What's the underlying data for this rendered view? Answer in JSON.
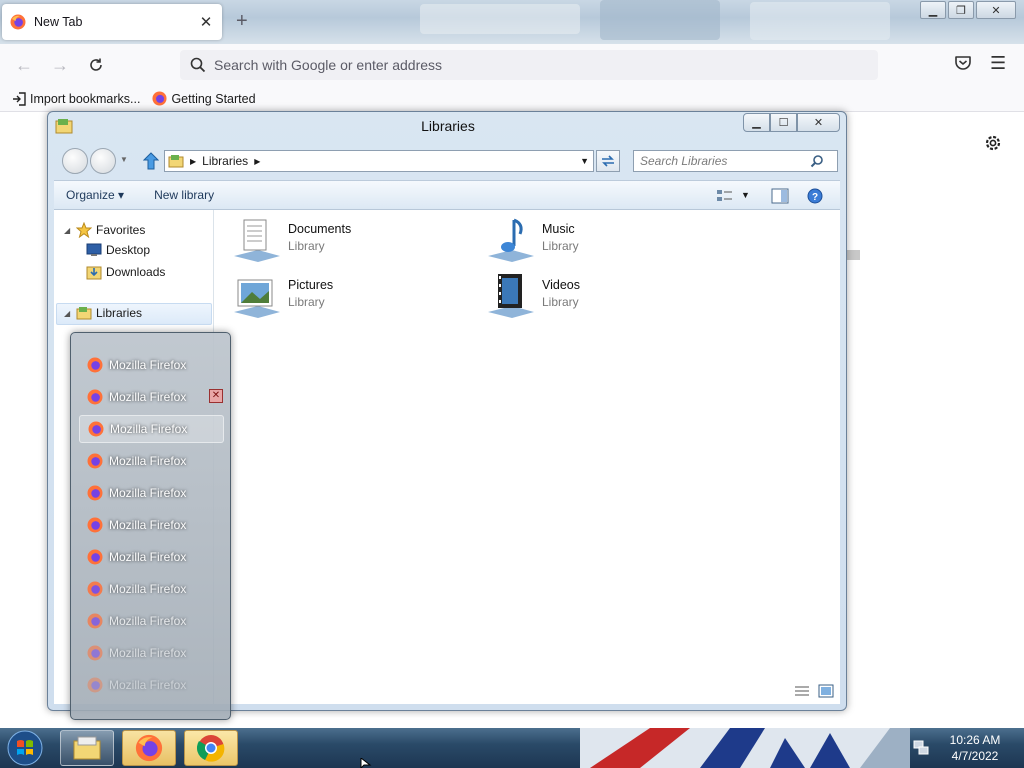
{
  "firefox": {
    "tab_title": "New Tab",
    "url_placeholder": "Search with Google or enter address",
    "bookmarks": [
      "Import bookmarks...",
      "Getting Started"
    ]
  },
  "libraries": {
    "window_title": "Libraries",
    "address_crumb": "Libraries",
    "search_placeholder": "Search Libraries",
    "toolbar": {
      "organize": "Organize ▾",
      "new_library": "New library"
    },
    "sidebar": {
      "favorites": "Favorites",
      "desktop": "Desktop",
      "downloads": "Downloads",
      "libraries": "Libraries"
    },
    "items": [
      {
        "name": "Documents",
        "type": "Library"
      },
      {
        "name": "Music",
        "type": "Library"
      },
      {
        "name": "Pictures",
        "type": "Library"
      },
      {
        "name": "Videos",
        "type": "Library"
      }
    ]
  },
  "thumbnail_list": {
    "items": [
      "Mozilla Firefox",
      "Mozilla Firefox",
      "Mozilla Firefox",
      "Mozilla Firefox",
      "Mozilla Firefox",
      "Mozilla Firefox",
      "Mozilla Firefox",
      "Mozilla Firefox",
      "Mozilla Firefox",
      "Mozilla Firefox",
      "Mozilla Firefox"
    ]
  },
  "taskbar": {
    "time": "10:26 AM",
    "date": "4/7/2022"
  }
}
